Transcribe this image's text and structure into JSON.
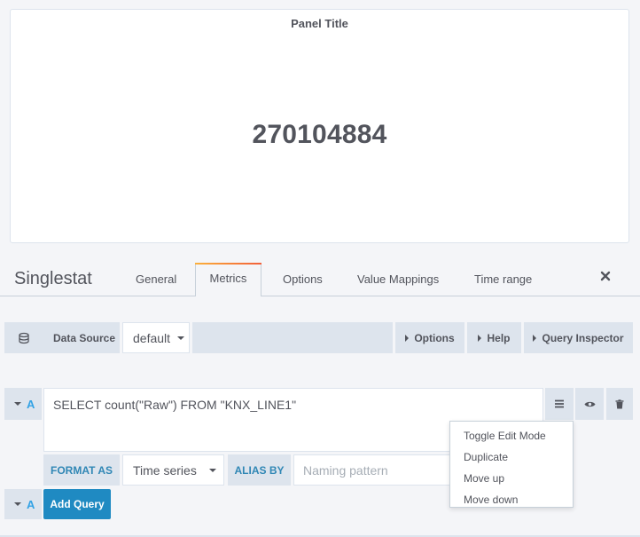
{
  "panel": {
    "title": "Panel Title",
    "value": "270104884"
  },
  "editor": {
    "title": "Singlestat",
    "tabs": [
      {
        "label": "General",
        "active": false
      },
      {
        "label": "Metrics",
        "active": true
      },
      {
        "label": "Options",
        "active": false
      },
      {
        "label": "Value Mappings",
        "active": false
      },
      {
        "label": "Time range",
        "active": false
      }
    ],
    "close_icon": "close-icon"
  },
  "datasource_row": {
    "icon": "database-icon",
    "label": "Data Source",
    "selected": "default",
    "options_label": "Options",
    "help_label": "Help",
    "inspector_label": "Query Inspector"
  },
  "query": {
    "ref_id": "A",
    "text": "SELECT count(\"Raw\") FROM \"KNX_LINE1\"",
    "menu_icon": "hamburger-icon",
    "eye_icon": "eye-icon",
    "trash_icon": "trash-icon",
    "format_as_label": "FORMAT AS",
    "format_as_value": "Time series",
    "alias_by_label": "ALIAS BY",
    "alias_placeholder": "Naming pattern"
  },
  "context_menu": {
    "items": [
      "Toggle Edit Mode",
      "Duplicate",
      "Move up",
      "Move down"
    ]
  },
  "add_row": {
    "ref_id": "A",
    "button_label": "Add Query"
  },
  "colors": {
    "accent_blue": "#1f8ac2",
    "label_blue": "#3087b5",
    "tab_gradient_start": "#fbb03b",
    "tab_gradient_end": "#f2603a"
  }
}
